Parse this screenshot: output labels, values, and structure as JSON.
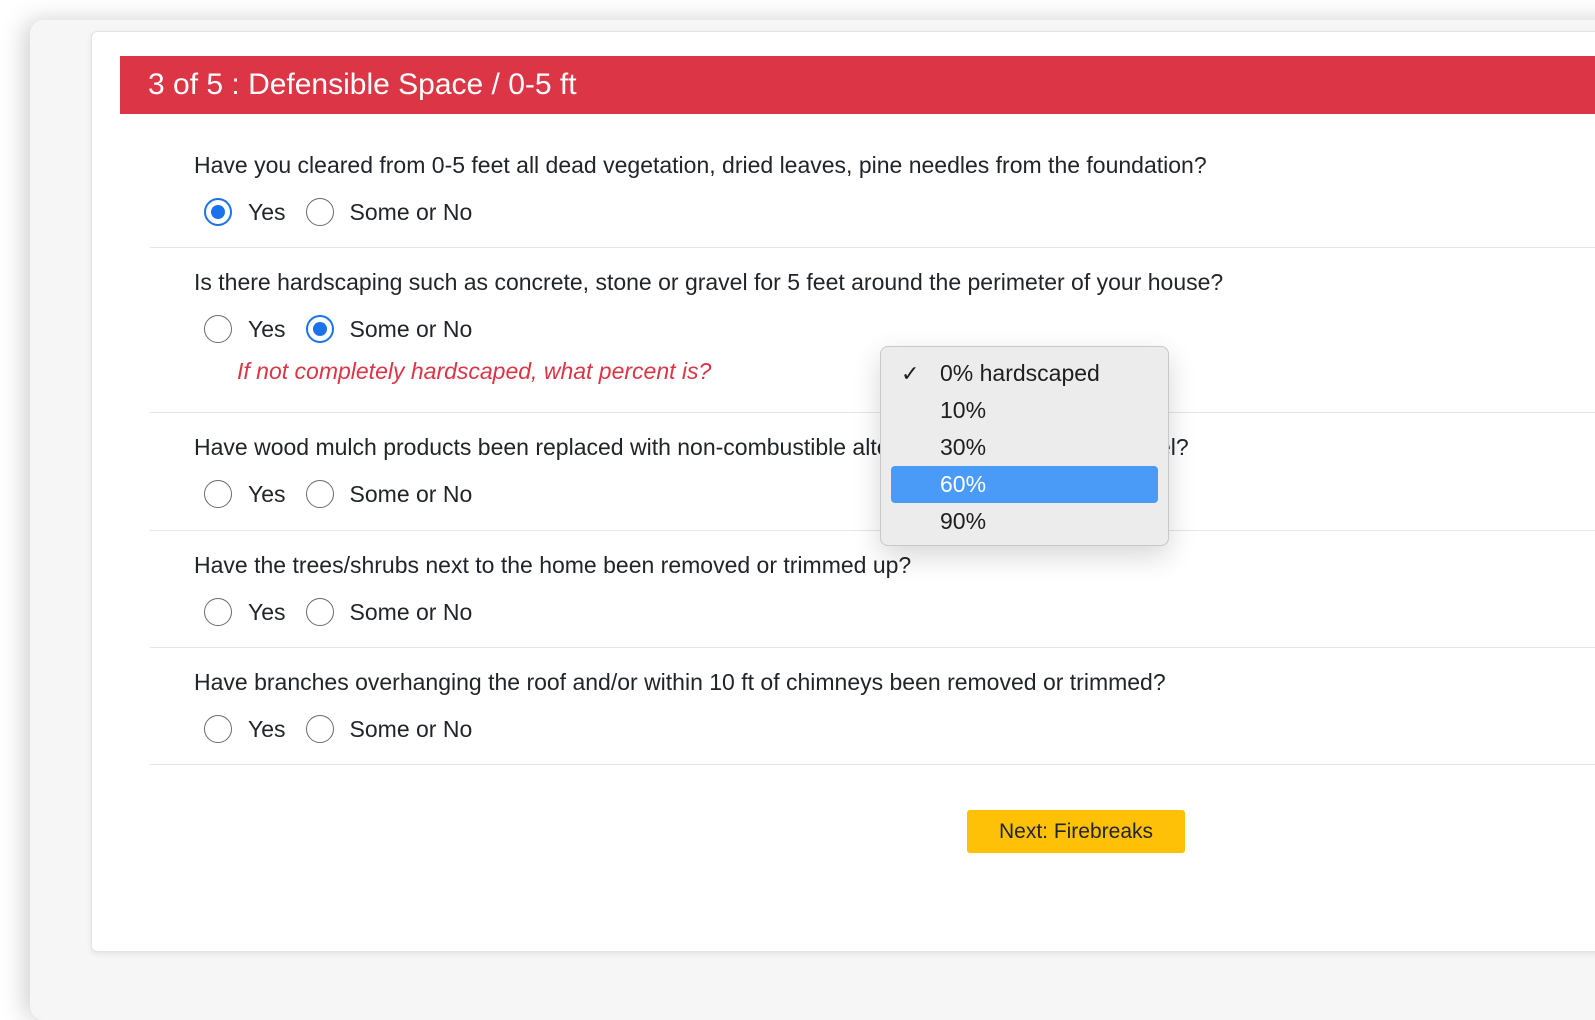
{
  "header": {
    "title": "3 of 5 : Defensible Space / 0-5 ft"
  },
  "options": {
    "yes": "Yes",
    "some_or_no": "Some or No"
  },
  "questions": [
    {
      "text": "Have you cleared from 0-5 feet all dead vegetation, dried leaves, pine needles from the foundation?",
      "selected": "yes"
    },
    {
      "text": "Is there hardscaping such as concrete, stone or gravel for 5 feet around the perimeter of your house?",
      "selected": "some_or_no",
      "followup": "If not completely hardscaped, what percent is?"
    },
    {
      "text": "Have wood mulch products been replaced with non-combustible alternatives, like stone or gravel?",
      "selected": null
    },
    {
      "text": "Have the trees/shrubs next to the home been removed or trimmed up?",
      "selected": null
    },
    {
      "text": "Have branches overhanging the roof and/or within 10 ft of chimneys been removed or trimmed?",
      "selected": null
    }
  ],
  "percent_dropdown": {
    "selected_value": "0% hardscaped",
    "highlighted_value": "60%",
    "items": [
      "0% hardscaped",
      "10%",
      "30%",
      "60%",
      "90%"
    ]
  },
  "next_button": {
    "label": "Next: Firebreaks"
  },
  "colors": {
    "header": "#dc3545",
    "followup": "#dc3545",
    "radio_checked": "#1a73e8",
    "highlight": "#4a9bf7",
    "button": "#ffc107"
  },
  "icons": {
    "selected_option": "checkmark-icon"
  }
}
